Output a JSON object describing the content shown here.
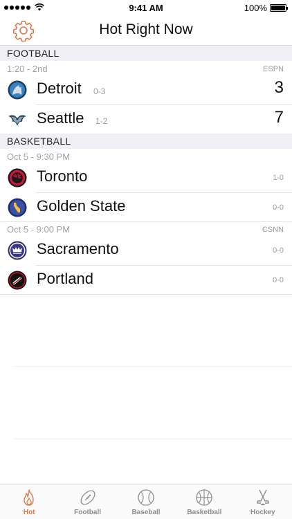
{
  "status_bar": {
    "time": "9:41 AM",
    "battery": "100%",
    "battery_level": 1.0
  },
  "header": {
    "title": "Hot Right Now",
    "settings_icon": "gear-icon"
  },
  "colors": {
    "accent": "#e2784a",
    "section_bg": "#efeff4",
    "muted": "#9a9a9a"
  },
  "sections": [
    {
      "label": "FOOTBALL",
      "games": [
        {
          "time": "1:20 - 2nd",
          "network": "ESPN",
          "teams": [
            {
              "name": "Detroit",
              "record": "0-3",
              "score": "3",
              "logo": "detroit-lions-logo"
            },
            {
              "name": "Seattle",
              "record": "1-2",
              "score": "7",
              "logo": "seattle-seahawks-logo"
            }
          ]
        }
      ]
    },
    {
      "label": "BASKETBALL",
      "games": [
        {
          "time": "Oct 5 - 9:30 PM",
          "network": "",
          "teams": [
            {
              "name": "Toronto",
              "record": "1-0",
              "logo": "toronto-raptors-logo"
            },
            {
              "name": "Golden State",
              "record": "0-0",
              "logo": "golden-state-logo"
            }
          ]
        },
        {
          "time": "Oct 5 - 9:00 PM",
          "network": "CSNN",
          "teams": [
            {
              "name": "Sacramento",
              "record": "0-0",
              "logo": "sacramento-kings-logo"
            },
            {
              "name": "Portland",
              "record": "0-0",
              "logo": "portland-blazers-logo"
            }
          ]
        }
      ]
    }
  ],
  "tabs": [
    {
      "label": "Hot",
      "icon": "flame-icon",
      "active": true
    },
    {
      "label": "Football",
      "icon": "football-icon",
      "active": false
    },
    {
      "label": "Baseball",
      "icon": "baseball-icon",
      "active": false
    },
    {
      "label": "Basketball",
      "icon": "basketball-icon",
      "active": false
    },
    {
      "label": "Hockey",
      "icon": "hockey-sticks-icon",
      "active": false
    }
  ]
}
